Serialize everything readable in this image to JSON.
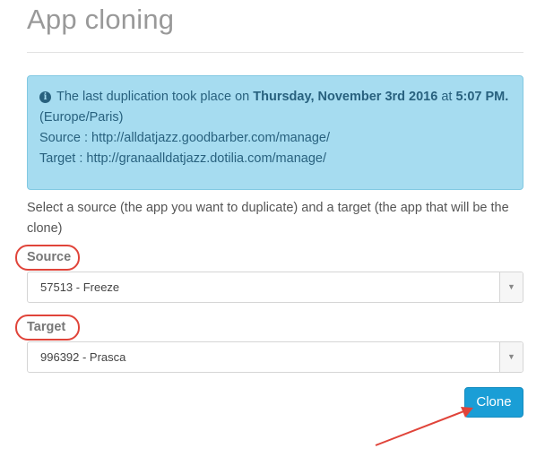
{
  "page": {
    "title": "App cloning"
  },
  "info": {
    "icon": "info-circle-icon",
    "prefix": "The last duplication took place on ",
    "date": "Thursday, November 3rd 2016",
    "at": " at ",
    "time": "5:07 PM.",
    "timezone": " (Europe/Paris)",
    "source_label": "Source : ",
    "source_url": "http://alldatjazz.goodbarber.com/manage/",
    "target_label": "Target : ",
    "target_url": "http://granaalldatjazz.dotilia.com/manage/"
  },
  "intro_text": "Select a source (the app you want to duplicate) and a target (the app that will be the clone)",
  "source": {
    "label": "Source",
    "selected": "57513 - Freeze"
  },
  "target": {
    "label": "Target",
    "selected": "996392 - Prasca"
  },
  "actions": {
    "clone_label": "Clone"
  },
  "colors": {
    "info_background": "#a6dcf0",
    "button_primary": "#1a9ed6",
    "annotation_red": "#e0443a"
  }
}
